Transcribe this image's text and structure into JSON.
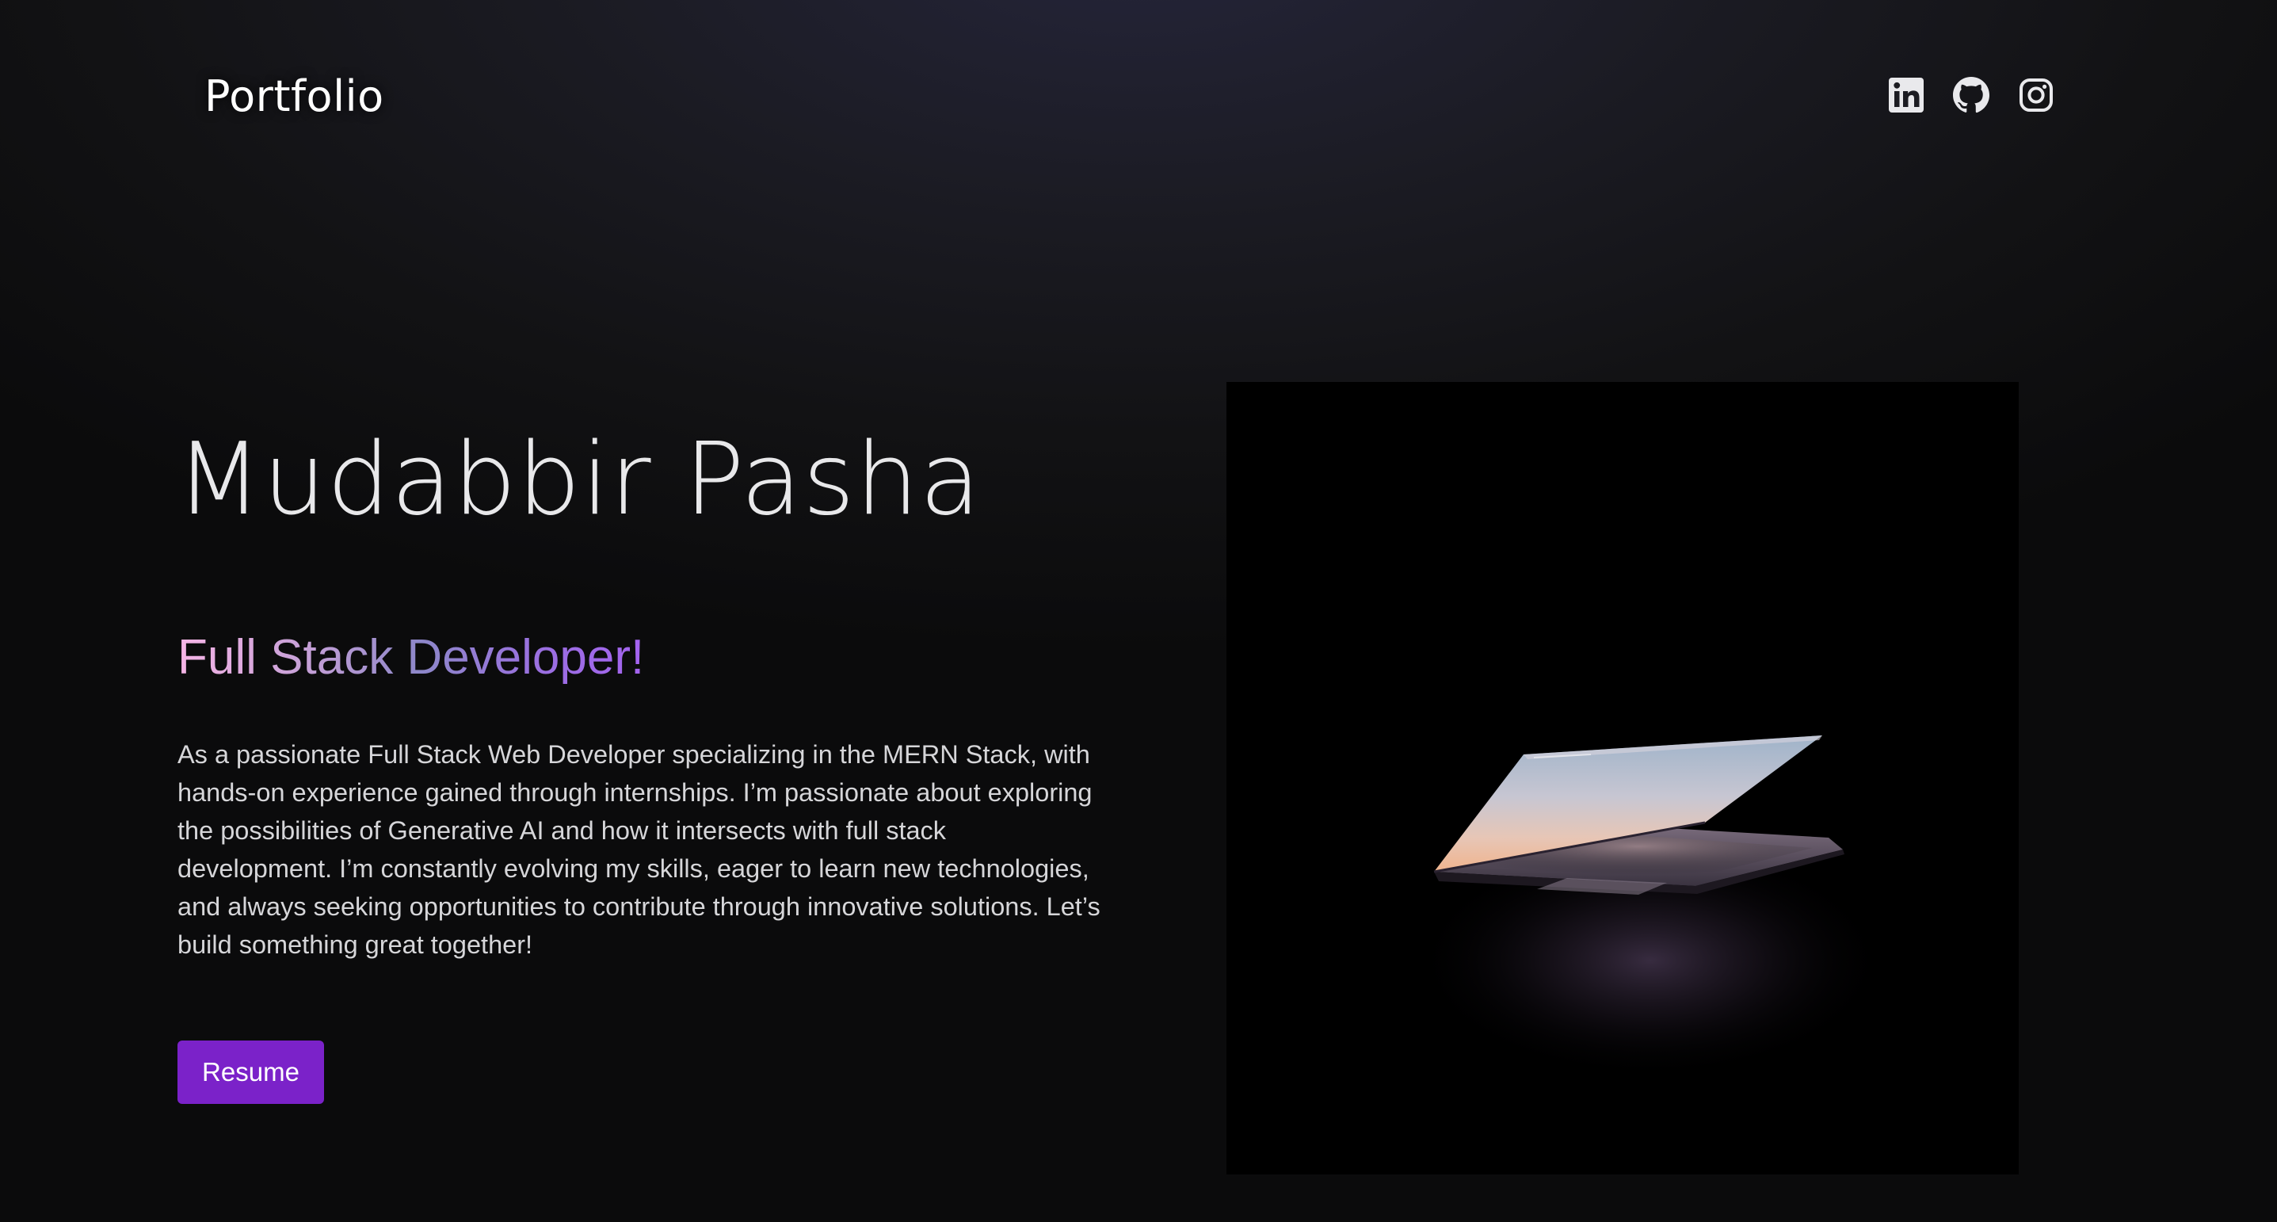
{
  "header": {
    "logo_text": "Portfolio",
    "social_links": [
      {
        "icon": "linkedin-icon"
      },
      {
        "icon": "github-icon"
      },
      {
        "icon": "instagram-icon"
      }
    ]
  },
  "hero": {
    "name": "Mudabbir Pasha",
    "role": "Full Stack Developer!",
    "bio": "As a passionate Full Stack Web Developer specializing in the MERN Stack, with hands-on experience gained through internships. I’m passionate about exploring the possibilities of Generative AI and how it intersects with full stack development. I’m constantly evolving my skills, eager to learn new technologies, and always seeking opportunities to contribute through innovative solutions. Let’s build something great together!",
    "resume_label": "Resume",
    "image": "laptop-photo"
  },
  "colors": {
    "accent": "#7b22c9",
    "background": "#121214",
    "gradient_start": "#f6b5e6",
    "gradient_end": "#a463f0"
  }
}
